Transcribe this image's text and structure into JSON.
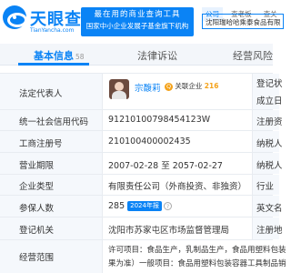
{
  "header": {
    "logo_text": "天眼查",
    "logo_sub": "TianYancha.com",
    "banner_line1": "最在用的商业查询工具",
    "banner_line2": "国家中小企业发展子基金旗下机构",
    "tabs": [
      "公司",
      "查老板",
      "查关"
    ],
    "search_value": "沈阳瑞哈哈乘泰食品有限"
  },
  "section_tabs": {
    "basic_label": "基本信息",
    "basic_count": "58",
    "legal_label": "法律诉讼",
    "risk_label": "经营风险"
  },
  "rows": {
    "rep": {
      "label": "法定代表人",
      "name": "宗馥莉",
      "related_text": "关联企业",
      "related_count": "216",
      "right_label": "登记状",
      "right_label2": "成立日"
    },
    "credit_code": {
      "label": "统一社会信用代码",
      "value": "91210100798454123W",
      "right_label": "注册资"
    },
    "reg_no": {
      "label": "工商注册号",
      "value": "210100400002435",
      "right_label": "纳税人"
    },
    "term": {
      "label": "营业期限",
      "value": "2007-02-28 至 2057-02-27",
      "right_label": "纳税人"
    },
    "type": {
      "label": "企业类型",
      "value": "有限责任公司（外商投资、非独资）",
      "right_label": "行业"
    },
    "insured": {
      "label": "参保人数",
      "value": "285",
      "year_badge": "2024年报",
      "right_label": "英文名"
    },
    "authority": {
      "label": "登记机关",
      "value": "沈阳市苏家屯区市场监督管理局",
      "right_label": "注册地"
    },
    "scope": {
      "label": "经营范围",
      "line1": "许可项目：食品生产，乳制品生产，食品用塑料包装",
      "line2": "果为准）一般项目：食品用塑料包装容器工具制品销"
    }
  }
}
